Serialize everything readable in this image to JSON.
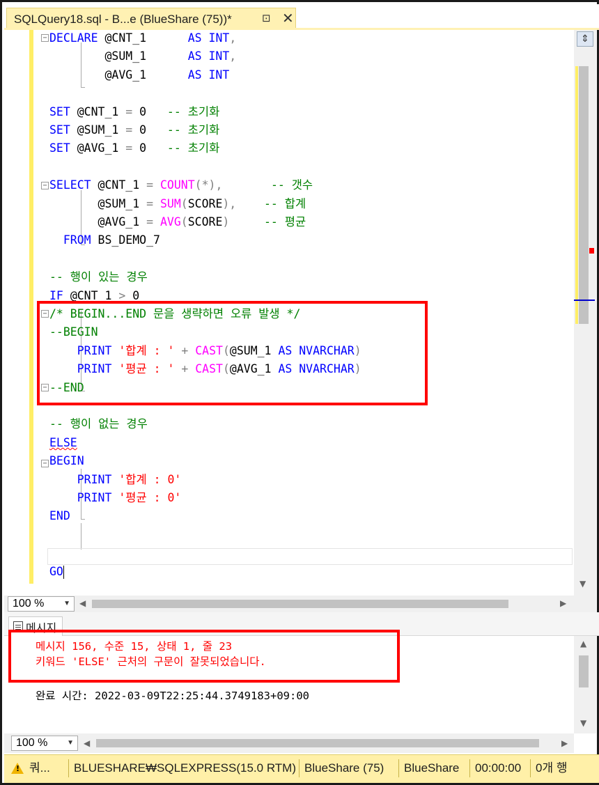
{
  "tab": {
    "title": "SQLQuery18.sql - B...e (BlueShare (75))*",
    "pin_icon": "pin-icon",
    "close_icon": "close-icon"
  },
  "editor": {
    "lines": [
      [
        {
          "c": "kw",
          "t": "DECLARE "
        },
        {
          "c": "tx",
          "t": "@CNT_1      "
        },
        {
          "c": "kw",
          "t": "AS INT"
        },
        {
          "c": "op",
          "t": ","
        }
      ],
      [
        {
          "c": "tx",
          "t": "        @SUM_1      "
        },
        {
          "c": "kw",
          "t": "AS INT"
        },
        {
          "c": "op",
          "t": ","
        }
      ],
      [
        {
          "c": "tx",
          "t": "        @AVG_1      "
        },
        {
          "c": "kw",
          "t": "AS INT"
        }
      ],
      [],
      [
        {
          "c": "kw",
          "t": "SET "
        },
        {
          "c": "tx",
          "t": "@CNT_1 "
        },
        {
          "c": "op",
          "t": "= "
        },
        {
          "c": "tx",
          "t": "0   "
        },
        {
          "c": "cm",
          "t": "-- 초기화"
        }
      ],
      [
        {
          "c": "kw",
          "t": "SET "
        },
        {
          "c": "tx",
          "t": "@SUM_1 "
        },
        {
          "c": "op",
          "t": "= "
        },
        {
          "c": "tx",
          "t": "0   "
        },
        {
          "c": "cm",
          "t": "-- 초기화"
        }
      ],
      [
        {
          "c": "kw",
          "t": "SET "
        },
        {
          "c": "tx",
          "t": "@AVG_1 "
        },
        {
          "c": "op",
          "t": "= "
        },
        {
          "c": "tx",
          "t": "0   "
        },
        {
          "c": "cm",
          "t": "-- 초기화"
        }
      ],
      [],
      [
        {
          "c": "kw",
          "t": "SELECT "
        },
        {
          "c": "tx",
          "t": "@CNT_1 "
        },
        {
          "c": "op",
          "t": "= "
        },
        {
          "c": "fn",
          "t": "COUNT"
        },
        {
          "c": "op",
          "t": "(*),"
        },
        {
          "c": "tx",
          "t": "       "
        },
        {
          "c": "cm",
          "t": "-- 갯수"
        }
      ],
      [
        {
          "c": "tx",
          "t": "       @SUM_1 "
        },
        {
          "c": "op",
          "t": "= "
        },
        {
          "c": "fn",
          "t": "SUM"
        },
        {
          "c": "op",
          "t": "("
        },
        {
          "c": "tx",
          "t": "SCORE"
        },
        {
          "c": "op",
          "t": "),"
        },
        {
          "c": "tx",
          "t": "    "
        },
        {
          "c": "cm",
          "t": "-- 합계"
        }
      ],
      [
        {
          "c": "tx",
          "t": "       @AVG_1 "
        },
        {
          "c": "op",
          "t": "= "
        },
        {
          "c": "fn",
          "t": "AVG"
        },
        {
          "c": "op",
          "t": "("
        },
        {
          "c": "tx",
          "t": "SCORE"
        },
        {
          "c": "op",
          "t": ")"
        },
        {
          "c": "tx",
          "t": "     "
        },
        {
          "c": "cm",
          "t": "-- 평균"
        }
      ],
      [
        {
          "c": "tx",
          "t": "  "
        },
        {
          "c": "kw",
          "t": "FROM "
        },
        {
          "c": "tx",
          "t": "BS_DEMO_7"
        }
      ],
      [],
      [
        {
          "c": "cm",
          "t": "-- 행이 있는 경우"
        }
      ],
      [
        {
          "c": "kw",
          "t": "IF "
        },
        {
          "c": "tx",
          "t": "@CNT_1 "
        },
        {
          "c": "op",
          "t": "> "
        },
        {
          "c": "tx",
          "t": "0"
        }
      ],
      [
        {
          "c": "cm",
          "t": "/* BEGIN...END 문을 생략하면 오류 발생 */"
        }
      ],
      [
        {
          "c": "cm",
          "t": "--BEGIN"
        }
      ],
      [
        {
          "c": "tx",
          "t": "    "
        },
        {
          "c": "kw",
          "t": "PRINT "
        },
        {
          "c": "str",
          "t": "'합계 : ' "
        },
        {
          "c": "op",
          "t": "+ "
        },
        {
          "c": "fn",
          "t": "CAST"
        },
        {
          "c": "op",
          "t": "("
        },
        {
          "c": "tx",
          "t": "@SUM_1 "
        },
        {
          "c": "kw",
          "t": "AS NVARCHAR"
        },
        {
          "c": "op",
          "t": ")"
        }
      ],
      [
        {
          "c": "tx",
          "t": "    "
        },
        {
          "c": "kw",
          "t": "PRINT "
        },
        {
          "c": "str",
          "t": "'평균 : ' "
        },
        {
          "c": "op",
          "t": "+ "
        },
        {
          "c": "fn",
          "t": "CAST"
        },
        {
          "c": "op",
          "t": "("
        },
        {
          "c": "tx",
          "t": "@AVG_1 "
        },
        {
          "c": "kw",
          "t": "AS NVARCHAR"
        },
        {
          "c": "op",
          "t": ")"
        }
      ],
      [
        {
          "c": "cm",
          "t": "--END"
        }
      ],
      [],
      [
        {
          "c": "cm",
          "t": "-- 행이 없는 경우"
        }
      ],
      [
        {
          "c": "kw squiggle",
          "t": "ELSE"
        }
      ],
      [
        {
          "c": "kw",
          "t": "BEGIN"
        }
      ],
      [
        {
          "c": "tx",
          "t": "    "
        },
        {
          "c": "kw",
          "t": "PRINT "
        },
        {
          "c": "str",
          "t": "'합계 : 0'"
        }
      ],
      [
        {
          "c": "tx",
          "t": "    "
        },
        {
          "c": "kw",
          "t": "PRINT "
        },
        {
          "c": "str",
          "t": "'평균 : 0'"
        }
      ],
      [
        {
          "c": "kw",
          "t": "END"
        }
      ],
      [],
      [],
      [
        {
          "c": "kw",
          "t": "GO"
        }
      ]
    ],
    "zoom": "100 %"
  },
  "results": {
    "tab_label": "메시지",
    "error_line1": "메시지 156, 수준 15, 상태 1, 줄 23",
    "error_line2": "키워드 'ELSE' 근처의 구문이 잘못되었습니다.",
    "completion": "완료 시간: 2022-03-09T22:25:44.3749183+09:00",
    "zoom": "100 %"
  },
  "statusbar": {
    "query_status": "쿼...",
    "server": "BLUESHARE₩SQLEXPRESS(15.0 RTM)",
    "user": "BlueShare (75)",
    "database": "BlueShare",
    "elapsed": "00:00:00",
    "rows": "0개 행"
  },
  "colors": {
    "keyword": "#0000ff",
    "function": "#ff00ff",
    "comment": "#008000",
    "string": "#ff0000",
    "annotation": "#ff0000",
    "statusbar": "#fff0a8"
  }
}
